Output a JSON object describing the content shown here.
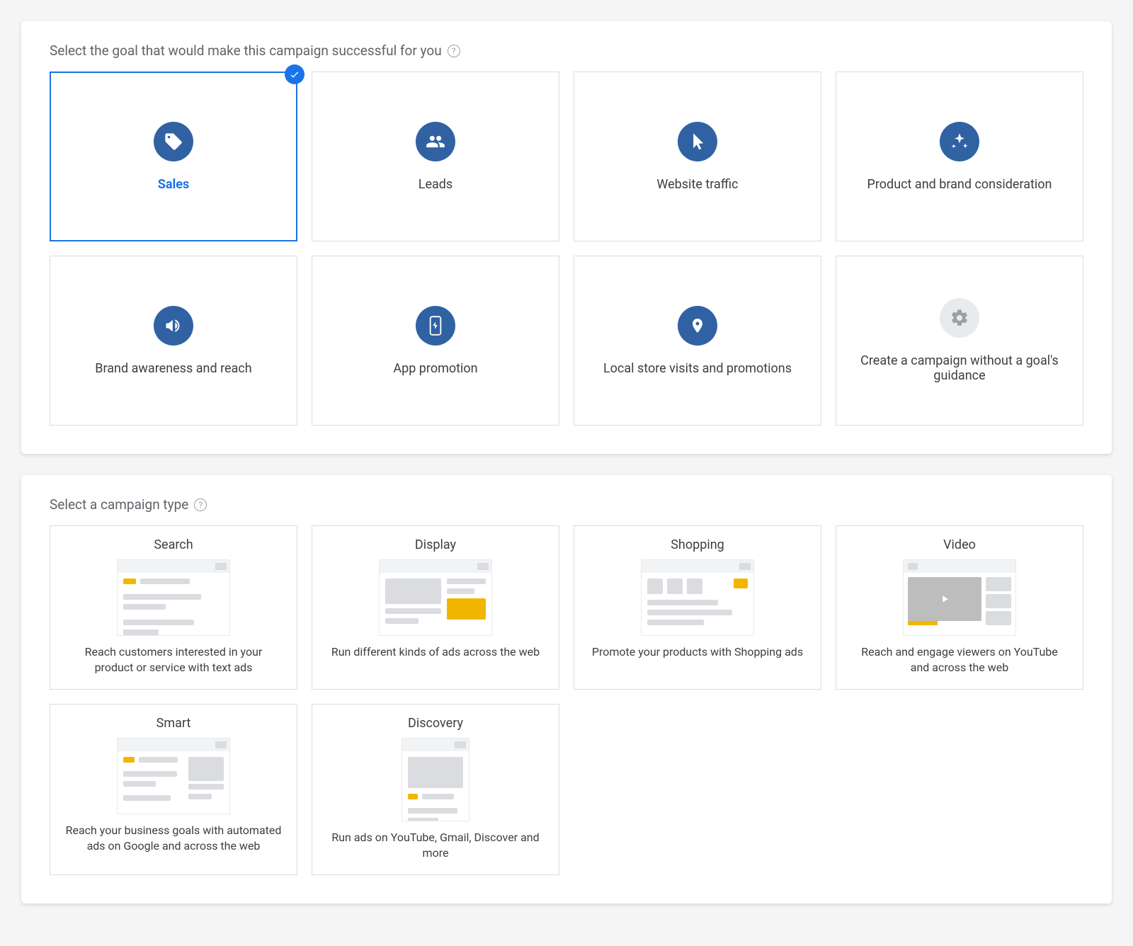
{
  "goals": {
    "heading": "Select the goal that would make this campaign successful for you",
    "items": [
      {
        "label": "Sales",
        "selected": true,
        "icon": "tag"
      },
      {
        "label": "Leads",
        "icon": "people"
      },
      {
        "label": "Website traffic",
        "icon": "cursor"
      },
      {
        "label": "Product and brand consideration",
        "icon": "sparkle"
      },
      {
        "label": "Brand awareness and reach",
        "icon": "megaphone"
      },
      {
        "label": "App promotion",
        "icon": "phone"
      },
      {
        "label": "Local store visits and promotions",
        "icon": "pin"
      },
      {
        "label": "Create a campaign without a goal's guidance",
        "icon": "gear",
        "muted": true
      }
    ]
  },
  "types": {
    "heading": "Select a campaign type",
    "items": [
      {
        "title": "Search",
        "desc": "Reach customers interested in your product or service with text ads"
      },
      {
        "title": "Display",
        "desc": "Run different kinds of ads across the web"
      },
      {
        "title": "Shopping",
        "desc": "Promote your products with Shopping ads"
      },
      {
        "title": "Video",
        "desc": "Reach and engage viewers on YouTube and across the web"
      },
      {
        "title": "Smart",
        "desc": "Reach your business goals with automated ads on Google and across the web"
      },
      {
        "title": "Discovery",
        "desc": "Run ads on YouTube, Gmail, Discover and more"
      }
    ]
  },
  "colors": {
    "accent": "#1a73e8",
    "iconBg": "#3062a3"
  }
}
